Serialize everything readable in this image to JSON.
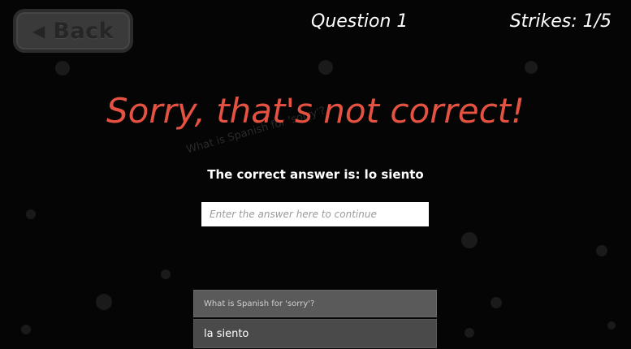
{
  "header": {
    "back_label": "Back",
    "back_icon": "chevron-left-icon",
    "question_label": "Question 1",
    "strikes_label": "Strikes: 1/5"
  },
  "feedback": {
    "title": "Sorry, that's not correct!",
    "correct_answer_text": "The correct answer is: lo siento",
    "watermark_text": "What is Spanish for 'sorry'?"
  },
  "input": {
    "placeholder": "Enter the answer here to continue",
    "value": ""
  },
  "history": {
    "question": "What is Spanish for 'sorry'?",
    "answer": "la siento"
  },
  "colors": {
    "background": "#050505",
    "error_red": "#e55241",
    "text": "#ffffff"
  }
}
